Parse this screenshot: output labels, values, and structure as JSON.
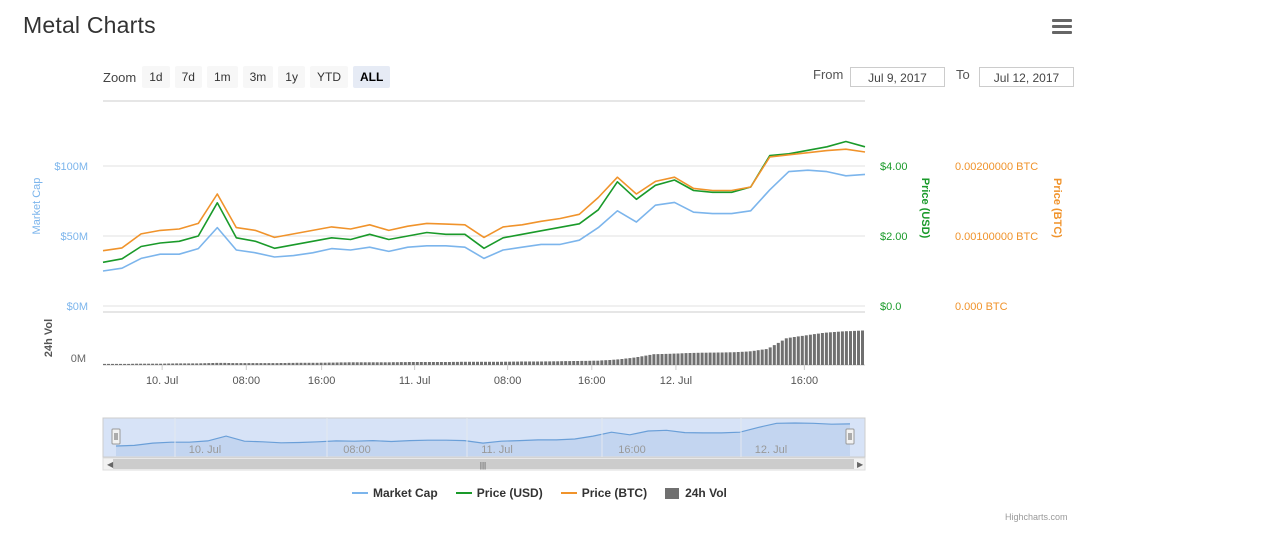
{
  "page": {
    "title": "Metal Charts",
    "credits": "Highcharts.com"
  },
  "zoom": {
    "label": "Zoom",
    "buttons": [
      "1d",
      "7d",
      "1m",
      "3m",
      "1y",
      "YTD",
      "ALL"
    ],
    "active": "ALL"
  },
  "range": {
    "from_label": "From",
    "from_value": "Jul 9, 2017",
    "to_label": "To",
    "to_value": "Jul 12, 2017"
  },
  "colors": {
    "market_cap": "#7cb5ec",
    "price_usd": "#1a9a2a",
    "price_btc": "#f0932b",
    "volume": "#707070",
    "navigator_fill": "#d7e3f7"
  },
  "chart_data": {
    "type": "line",
    "axes": {
      "market_cap": {
        "label": "Market Cap",
        "ticks": [
          "$0M",
          "$50M",
          "$100M"
        ],
        "range": [
          0,
          100
        ]
      },
      "price_usd": {
        "label": "Price (USD)",
        "ticks": [
          "$0.0",
          "$2.00",
          "$4.00"
        ],
        "range": [
          0,
          4
        ]
      },
      "price_btc": {
        "label": "Price (BTC)",
        "ticks": [
          "0.000 BTC",
          "0.00100000 BTC",
          "0.00200000 BTC"
        ],
        "range": [
          0,
          0.002
        ]
      },
      "volume": {
        "label": "24h Vol",
        "ticks": [
          "0M"
        ]
      },
      "x_ticks": [
        "10. Jul",
        "08:00",
        "16:00",
        "11. Jul",
        "08:00",
        "16:00",
        "12. Jul",
        "16:00"
      ]
    },
    "time_hours": [
      0,
      2,
      4,
      6,
      8,
      10,
      12,
      14,
      16,
      18,
      20,
      22,
      24,
      26,
      28,
      30,
      32,
      34,
      36,
      38,
      40,
      42,
      44,
      46,
      48,
      50,
      52,
      54,
      56,
      58,
      60,
      62,
      64,
      66,
      68,
      70,
      72,
      74,
      76,
      78,
      80
    ],
    "series": [
      {
        "name": "Market Cap",
        "axis": "market_cap",
        "values": [
          25,
          27,
          34,
          37,
          37,
          41,
          56,
          40,
          38,
          35,
          36,
          38,
          41,
          40,
          42,
          39,
          42,
          43,
          43,
          42,
          34,
          40,
          42,
          44,
          44,
          47,
          56,
          68,
          60,
          72,
          74,
          67,
          66,
          66,
          68,
          83,
          96,
          97,
          96,
          93,
          94
        ]
      },
      {
        "name": "Price (USD)",
        "axis": "price_usd",
        "values": [
          1.25,
          1.35,
          1.7,
          1.8,
          1.85,
          2.0,
          2.95,
          1.95,
          1.85,
          1.65,
          1.75,
          1.85,
          1.95,
          1.9,
          2.05,
          1.9,
          2.0,
          2.1,
          2.05,
          2.05,
          1.65,
          1.95,
          2.05,
          2.15,
          2.25,
          2.35,
          2.75,
          3.55,
          3.05,
          3.45,
          3.6,
          3.3,
          3.25,
          3.25,
          3.4,
          4.3,
          4.35,
          4.45,
          4.55,
          4.7,
          4.55
        ]
      },
      {
        "name": "Price (BTC)",
        "axis": "price_btc",
        "values": [
          0.00079,
          0.00083,
          0.00103,
          0.00108,
          0.0011,
          0.00118,
          0.0016,
          0.00112,
          0.00108,
          0.00098,
          0.00103,
          0.00108,
          0.00113,
          0.0011,
          0.00116,
          0.00108,
          0.00114,
          0.00118,
          0.00117,
          0.00116,
          0.00098,
          0.00113,
          0.00116,
          0.00121,
          0.00125,
          0.00131,
          0.00155,
          0.00184,
          0.0016,
          0.00178,
          0.00184,
          0.00168,
          0.00165,
          0.00165,
          0.0017,
          0.00213,
          0.00216,
          0.00219,
          0.00222,
          0.00224,
          0.0022
        ]
      },
      {
        "name": "24h Vol",
        "axis": "volume",
        "values": [
          0.4,
          0.4,
          0.5,
          0.5,
          0.6,
          0.6,
          0.8,
          0.7,
          0.7,
          0.7,
          0.8,
          0.8,
          0.9,
          1,
          1,
          1,
          1.1,
          1.1,
          1.1,
          1.2,
          1.2,
          1.2,
          1.3,
          1.3,
          1.4,
          1.5,
          1.6,
          2,
          2.8,
          4,
          4.2,
          4.5,
          4.6,
          4.7,
          5,
          6,
          10,
          11,
          12,
          12.5,
          12.8
        ]
      }
    ]
  }
}
